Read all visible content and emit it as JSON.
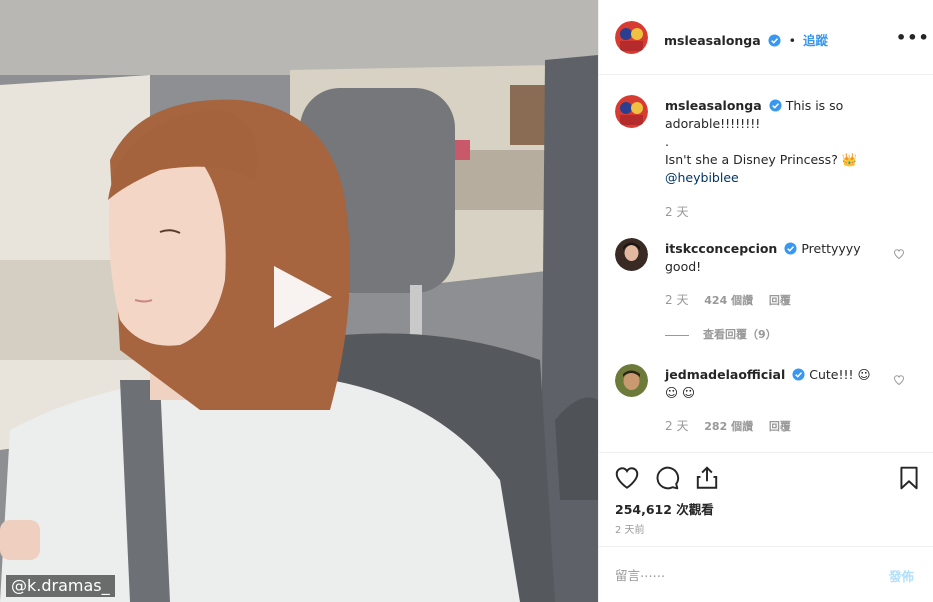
{
  "media": {
    "watermark": "@k.dramas_",
    "play_icon": "play-icon"
  },
  "header": {
    "username": "msleasalonga",
    "verified": true,
    "separator": "•",
    "follow_label": "追蹤",
    "more_label": "•••"
  },
  "caption": {
    "username": "msleasalonga",
    "lines": [
      "This is so",
      "adorable!!!!!!!!",
      ".",
      "Isn't she a Disney Princess? 👑"
    ],
    "mention": "@heybiblee",
    "time": "2 天"
  },
  "comments": [
    {
      "username": "itskcconcepcion",
      "text": "Prettyyyy good!",
      "time": "2 天",
      "likes": "424 個讚",
      "reply": "回覆",
      "view_replies": "查看回覆（9）"
    },
    {
      "username": "jedmadelaofficial",
      "text": "Cute!!! ☺ ☺ ☺",
      "time": "2 天",
      "likes": "282 個讚",
      "reply": "回覆"
    }
  ],
  "actions": {
    "views": "254,612 次觀看",
    "time_ago": "2 天前"
  },
  "comment_box": {
    "placeholder": "留言⋯⋯",
    "post_label": "發佈"
  },
  "colors": {
    "accent": "#3897f0",
    "verified": "#3897f0",
    "post_disabled": "#b2dffc",
    "muted": "#999999",
    "border": "#efefef"
  }
}
